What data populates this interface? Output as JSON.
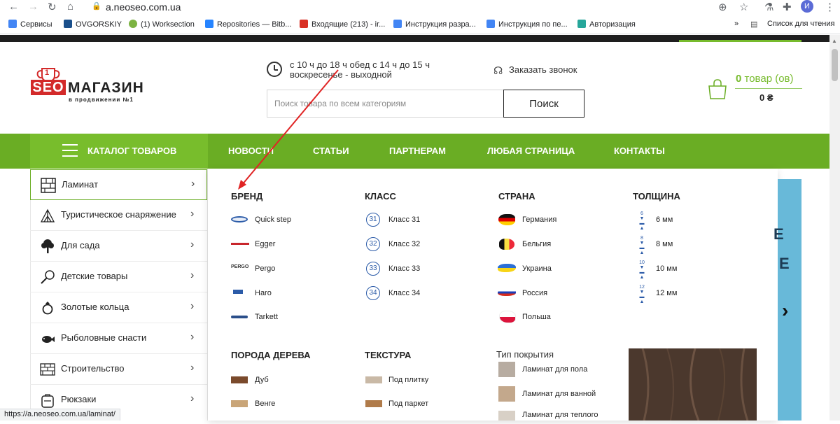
{
  "browser": {
    "url": "a.neoseo.com.ua",
    "avatar_letter": "И",
    "bookmarks": [
      {
        "label": "Сервисы",
        "color": "#4285f4"
      },
      {
        "label": "OVGORSKIY",
        "color": "#1a4f8b"
      },
      {
        "label": "(1) Worksection",
        "color": "#7cb342"
      },
      {
        "label": "Repositories — Bitb...",
        "color": "#2684ff"
      },
      {
        "label": "Входящие (213) - ir...",
        "color": "#d93025"
      },
      {
        "label": "Инструкция разра...",
        "color": "#4285f4"
      },
      {
        "label": "Инструкция по пе...",
        "color": "#4285f4"
      },
      {
        "label": "Авторизация",
        "color": "#26a69a"
      }
    ],
    "bookmarks_more": "»",
    "reading_list": "Список для чтения",
    "status_url": "https://a.neoseo.com.ua/laminat/"
  },
  "header": {
    "logo": {
      "badge_number": "1",
      "seo": "SEO",
      "name": "МАГАЗИН",
      "tagline": "в продвижении №1"
    },
    "hours_line1": "с 10 ч до 18 ч обед с 14 ч до 15 ч",
    "hours_line2": "воскресенье - выходной",
    "callback": "Заказать звонок",
    "search": {
      "placeholder": "Поиск товара по всем категориям",
      "button": "Поиск"
    },
    "cart": {
      "count_number": "0",
      "count_text": "товар (ов)",
      "total": "0 ₴"
    }
  },
  "nav": {
    "catalog": "КАТАЛОГ ТОВАРОВ",
    "links": [
      "НОВОСТИ",
      "СТАТЬИ",
      "ПАРТНЕРАМ",
      "ЛЮБАЯ СТРАНИЦА",
      "КОНТАКТЫ"
    ]
  },
  "sidemenu": [
    {
      "label": "Ламинат",
      "icon": "laminate-icon",
      "active": true
    },
    {
      "label": "Туристическое снаряжение",
      "icon": "tent-icon"
    },
    {
      "label": "Для сада",
      "icon": "tree-icon"
    },
    {
      "label": "Детские товары",
      "icon": "rattle-icon"
    },
    {
      "label": "Золотые кольца",
      "icon": "ring-icon"
    },
    {
      "label": "Рыболовные снасти",
      "icon": "fishing-icon"
    },
    {
      "label": "Строительство",
      "icon": "bricks-icon"
    },
    {
      "label": "Рюкзаки",
      "icon": "backpack-icon"
    }
  ],
  "mega": {
    "brand": {
      "title": "БРЕНД",
      "items": [
        "Quick step",
        "Egger",
        "Pergo",
        "Haro",
        "Tarkett"
      ]
    },
    "class": {
      "title": "КЛАСС",
      "items": [
        {
          "badge": "31",
          "label": "Класс 31"
        },
        {
          "badge": "32",
          "label": "Класс 32"
        },
        {
          "badge": "33",
          "label": "Класс 33"
        },
        {
          "badge": "34",
          "label": "Класс 34"
        }
      ]
    },
    "country": {
      "title": "СТРАНА",
      "items": [
        "Германия",
        "Бельгия",
        "Украина",
        "Россия",
        "Польша"
      ]
    },
    "thickness": {
      "title": "ТОЛЩИНА",
      "items": [
        {
          "badge": "6",
          "label": "6 мм"
        },
        {
          "badge": "8",
          "label": "8 мм"
        },
        {
          "badge": "10",
          "label": "10 мм"
        },
        {
          "badge": "12",
          "label": "12 мм"
        }
      ]
    },
    "wood": {
      "title": "ПОРОДА ДЕРЕВА",
      "items": [
        "Дуб",
        "Венге"
      ]
    },
    "texture": {
      "title": "ТЕКСТУРА",
      "items": [
        "Под плитку",
        "Под паркет"
      ]
    },
    "coating": {
      "title": "Тип покрытия",
      "items": [
        "Ламинат для пола",
        "Ламинат для ванной",
        "Ламинат для теплого"
      ]
    }
  },
  "banner": {
    "letter1": "Е",
    "letter2": "Е",
    "next": "›"
  },
  "colors": {
    "accent": "#6aad24",
    "logo_red": "#d32a2a",
    "annotation": "#e02424"
  }
}
